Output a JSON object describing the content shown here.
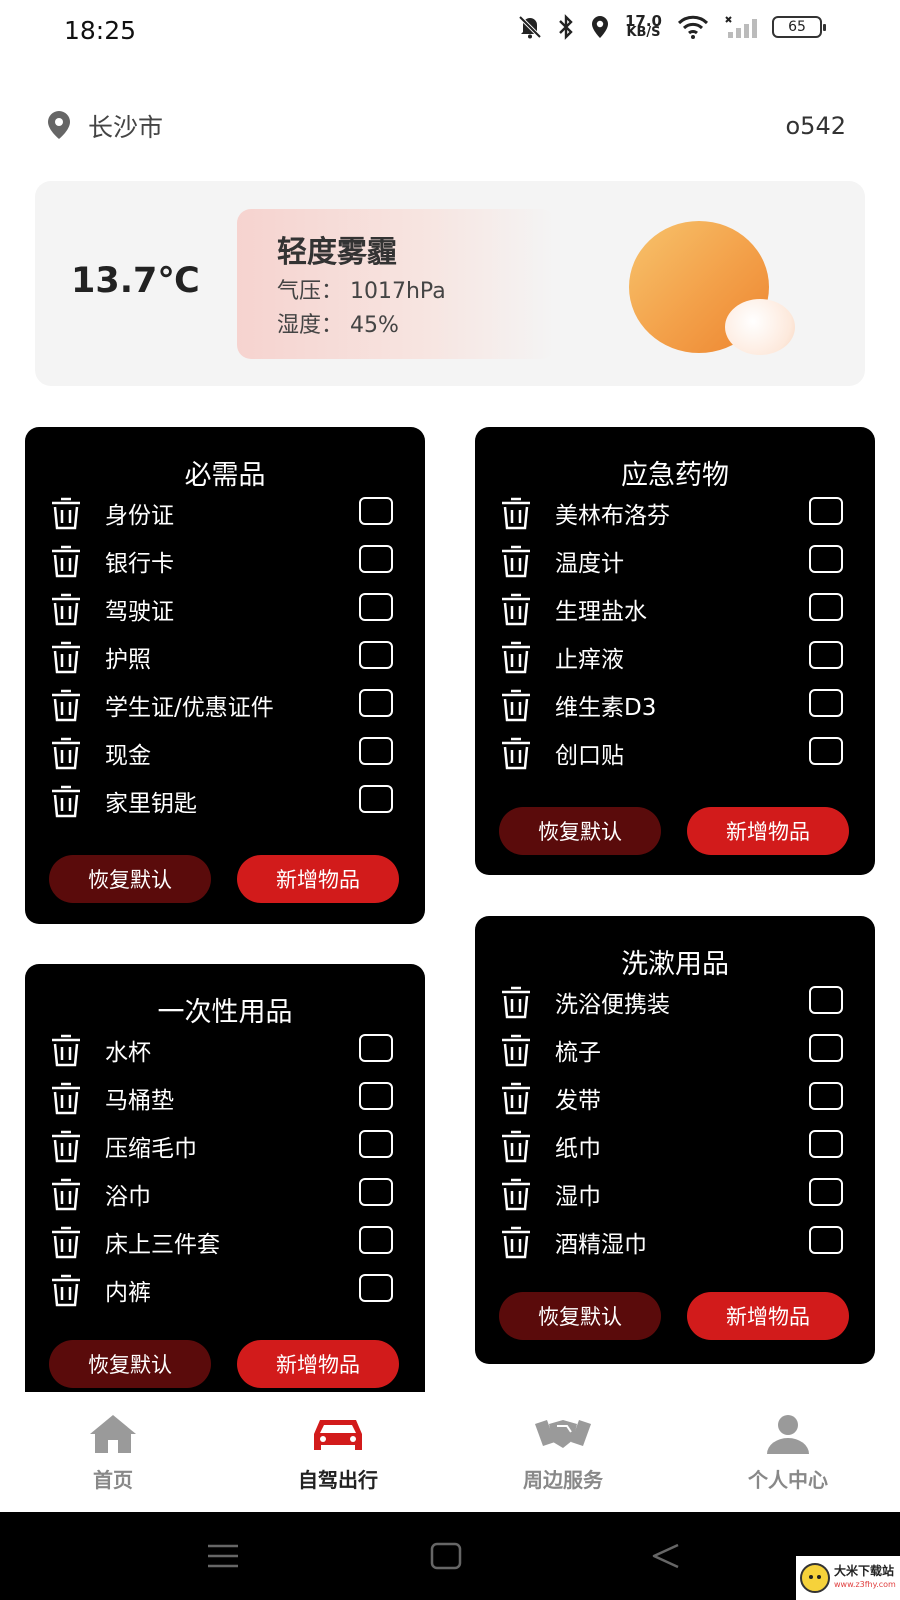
{
  "status_bar": {
    "time": "18:25",
    "net_speed_value": "17.0",
    "net_speed_unit": "KB/S",
    "battery": "65",
    "icons": [
      "bell-muted-icon",
      "bluetooth-icon",
      "location-icon",
      "wifi-icon",
      "signal-icon",
      "battery-icon"
    ]
  },
  "header": {
    "city": "长沙市",
    "user_code": "o542"
  },
  "weather": {
    "temperature": "13.7℃",
    "condition": "轻度雾霾",
    "pressure": "气压：  1017hPa",
    "humidity": "湿度：  45%"
  },
  "cards": {
    "necessities": {
      "title": "必需品",
      "items": [
        "身份证",
        "银行卡",
        "驾驶证",
        "护照",
        "学生证/优惠证件",
        "现金",
        "家里钥匙"
      ],
      "reset_label": "恢复默认",
      "add_label": "新增物品"
    },
    "medicine": {
      "title": "应急药物",
      "items": [
        "美林布洛芬",
        "温度计",
        "生理盐水",
        "止痒液",
        "维生素D3",
        "创口贴"
      ],
      "reset_label": "恢复默认",
      "add_label": "新增物品"
    },
    "disposable": {
      "title": "一次性用品",
      "items": [
        "水杯",
        "马桶垫",
        "压缩毛巾",
        "浴巾",
        "床上三件套",
        "内裤"
      ],
      "reset_label": "恢复默认",
      "add_label": "新增物品"
    },
    "toiletries": {
      "title": "洗漱用品",
      "items": [
        "洗浴便携装",
        "梳子",
        "发带",
        "纸巾",
        "湿巾",
        "酒精湿巾"
      ],
      "reset_label": "恢复默认",
      "add_label": "新增物品"
    }
  },
  "bottom_nav": {
    "items": [
      {
        "label": "首页",
        "icon": "home-icon",
        "active": false
      },
      {
        "label": "自驾出行",
        "icon": "car-icon",
        "active": true
      },
      {
        "label": "周边服务",
        "icon": "handshake-icon",
        "active": false
      },
      {
        "label": "个人中心",
        "icon": "person-icon",
        "active": false
      }
    ],
    "active_color": "#d21b1b",
    "inactive_color": "#9a9a9a"
  },
  "watermark": {
    "title": "大米下载站",
    "url": "www.z3fhy.com"
  }
}
